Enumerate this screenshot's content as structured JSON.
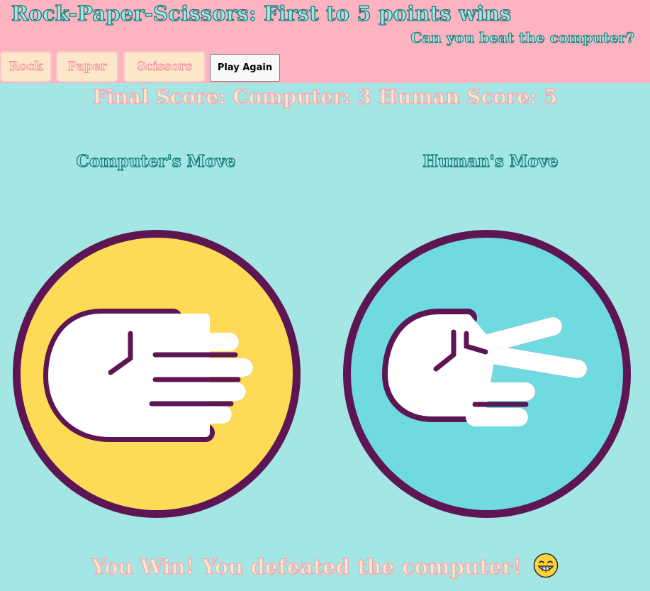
{
  "header": {
    "title": "Rock-Paper-Scissors: First to 5 points wins",
    "subtitle": "Can you beat the computer?"
  },
  "controls": {
    "rock_label": "Rock",
    "paper_label": "Paper",
    "scissors_label": "Scissors",
    "play_again_label": "Play Again"
  },
  "score": {
    "text": "Final Score: Computer: 3 Human Score: 5",
    "computer": 3,
    "human": 5
  },
  "moves": {
    "computer_heading": "Computer's Move",
    "human_heading": "Human's Move",
    "computer_move": "paper",
    "human_move": "scissors",
    "computer_icon": "paper-hand-icon",
    "human_icon": "scissors-hand-icon"
  },
  "result": {
    "text": "You Win! You defeated the computer!",
    "emoji_icon": "grinning-face-icon"
  },
  "colors": {
    "background": "#a3e6e3",
    "header_background": "#feb3c0",
    "outline_purple": "#5d1554",
    "computer_circle": "#fedb57",
    "human_circle": "#6fdae0"
  }
}
